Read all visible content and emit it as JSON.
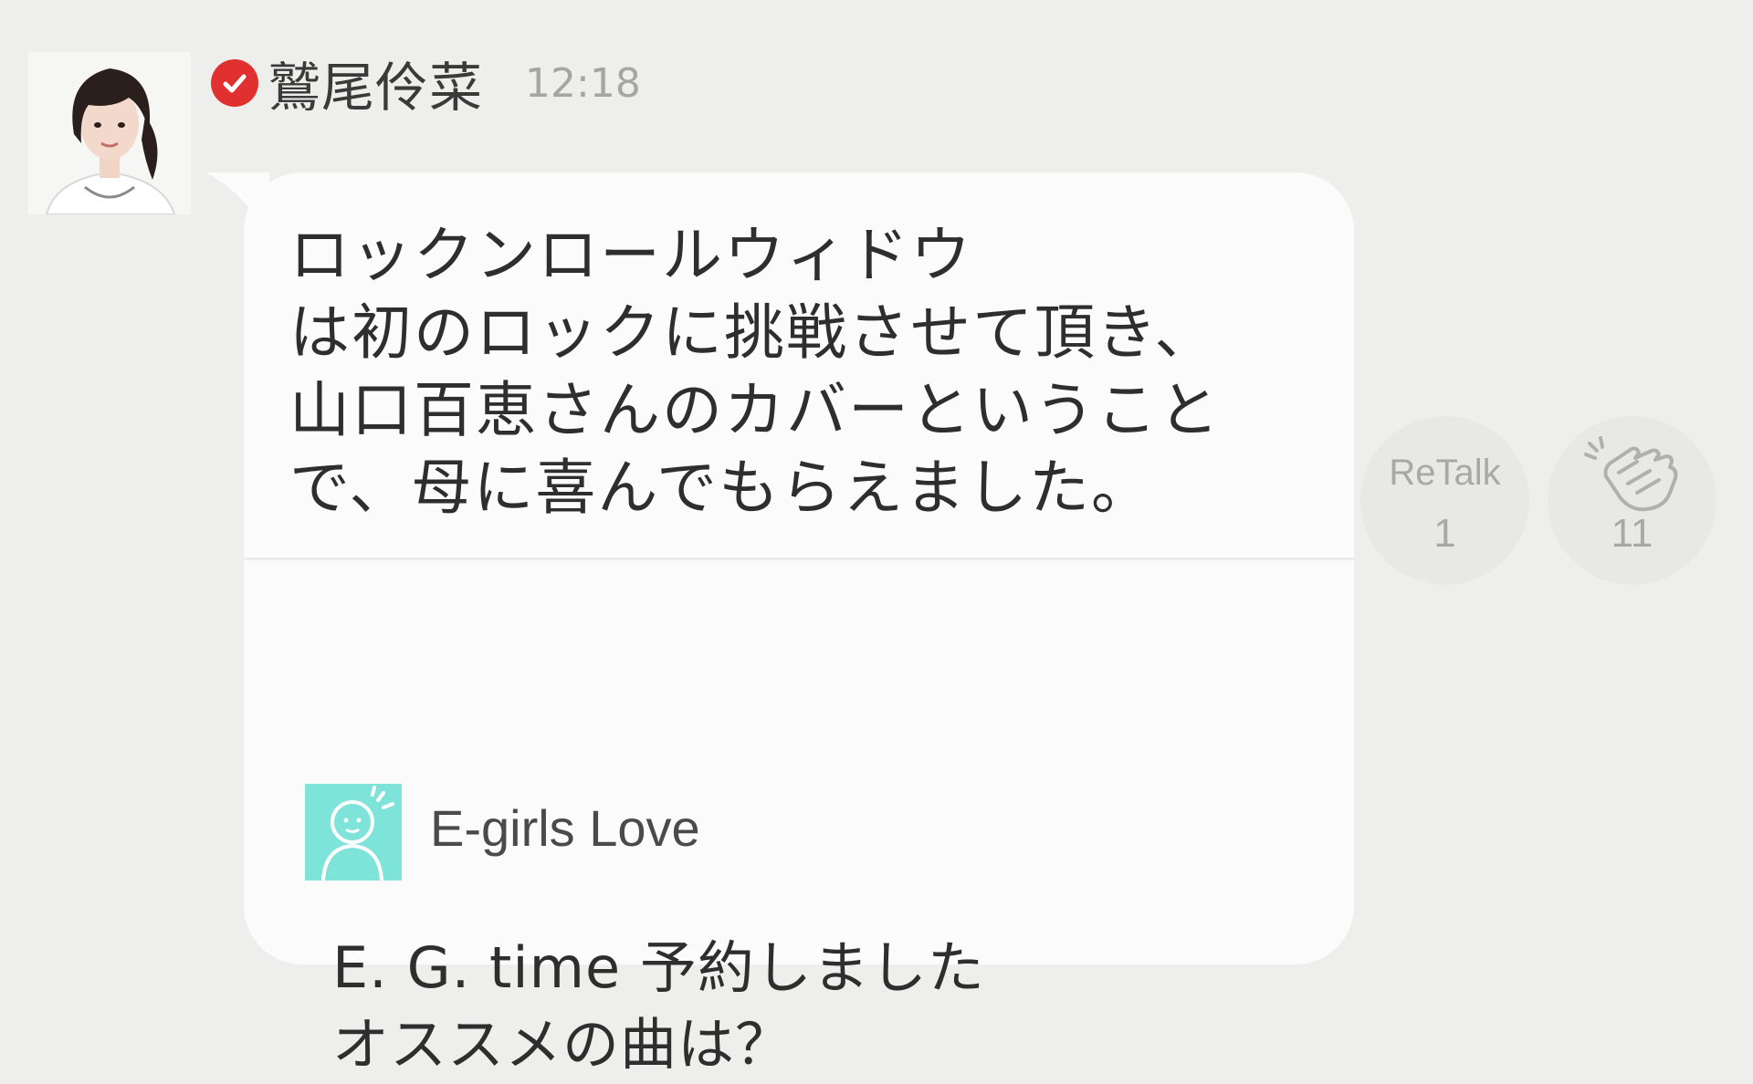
{
  "post": {
    "author_name": "鷲尾伶菜",
    "time": "12:18",
    "text": "ロックンロールウィドウ\nは初のロックに挑戦させて頂き、\n山口百恵さんのカバーということ\nで、母に喜んでもらえました。"
  },
  "quoted": {
    "author_name": "E-girls Love",
    "text": "E. G. time 予約しました\nオススメの曲は？"
  },
  "actions": {
    "retalk_label": "ReTalk",
    "retalk_count": "1",
    "clap_count": "11"
  },
  "icons": {
    "verified": "verified-check-icon",
    "clap": "clap-hands-icon",
    "default_avatar": "default-person-avatar-icon"
  },
  "colors": {
    "background": "#eeefed",
    "bubble": "#fafbfa",
    "verified": "#e0302f",
    "default_avatar_bg": "#7ee3d8"
  }
}
